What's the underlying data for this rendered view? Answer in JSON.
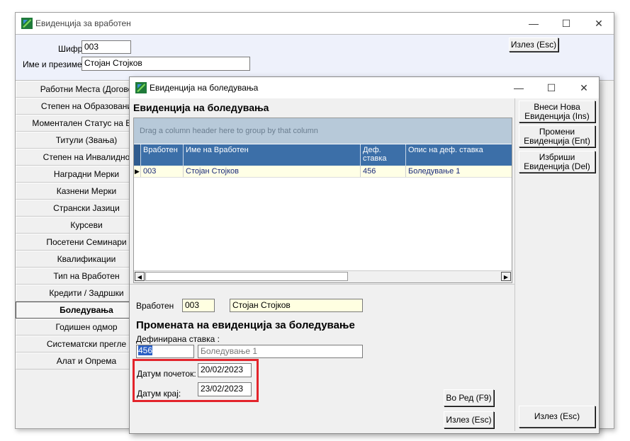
{
  "back_window": {
    "title": "Евиденција за вработен",
    "exit_button": "Излез (Esc)",
    "code_label": "Шифра:",
    "code_value": "003",
    "name_label": "Име и презиме:",
    "name_value": "Стојан  Стојков",
    "side_items": [
      {
        "label": "Работни Места (Догово"
      },
      {
        "label": "Степен на Образовани"
      },
      {
        "label": "Моментален Статус на Вра"
      },
      {
        "label": "Титули (Звања)"
      },
      {
        "label": "Степен на Инвалидно"
      },
      {
        "label": "Наградни Мерки"
      },
      {
        "label": "Казнени Мерки"
      },
      {
        "label": "Странски Јазици"
      },
      {
        "label": "Курсеви"
      },
      {
        "label": "Посетени Семинари"
      },
      {
        "label": "Квалификации"
      },
      {
        "label": "Тип на Вработен"
      },
      {
        "label": "Кредити / Задршки"
      },
      {
        "label": "Боледувања"
      },
      {
        "label": "Годишен одмор"
      },
      {
        "label": "Систематски прегле"
      },
      {
        "label": "Алат и Опрема"
      }
    ],
    "active_item_index": 13
  },
  "dialog": {
    "title": "Евиденција на боледувања",
    "section_title": "Евиденција на боледувања",
    "group_panel_hint": "Drag a column header here to group by that column",
    "columns": [
      "Вработен",
      "Име  на Вработен",
      "Деф. ставка",
      "Опис на деф. ставка"
    ],
    "rows": [
      [
        "003",
        "Стојан  Стојков",
        "456",
        "Боледување 1"
      ]
    ],
    "buttons": {
      "new": "Внеси Нова Евиденција (Ins)",
      "edit": "Промени Евиденција (Ent)",
      "delete": "Избриши Евиденција (Del)",
      "exit_right": "Излез (Esc)",
      "in_order": "Во Ред (F9)",
      "exit": "Излез (Esc)"
    },
    "employee_label": "Вработен",
    "employee_code": "003",
    "employee_name": "Стојан  Стојков",
    "change_title": "Промената на евиденција за боледување",
    "def_item_label": "Дефинирана ставка :",
    "def_item_code": "456",
    "def_item_desc": "Боледување 1",
    "start_label": "Датум почеток:",
    "start_value": "20/02/2023",
    "end_label": "Датум крај:",
    "end_value": "23/02/2023"
  },
  "colors": {
    "grid_header": "#3c6fa8",
    "group_panel": "#b7c9d9",
    "yellow_field": "#ffffe1",
    "highlight": "#e3242b"
  }
}
